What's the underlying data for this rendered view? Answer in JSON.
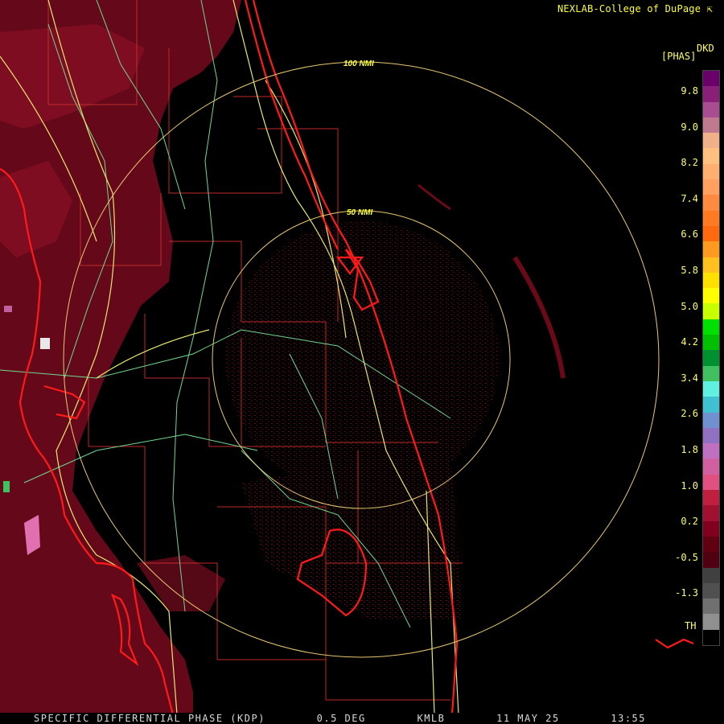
{
  "header": {
    "credit": "NEXLAB-College of DuPage ⇱"
  },
  "footer": {
    "product": "SPECIFIC DIFFERENTIAL PHASE (KDP)",
    "elevation": "0.5 DEG",
    "station": "KMLB",
    "date": "11 MAY 25",
    "time": "13:55"
  },
  "range_rings": [
    {
      "label": "100 NMI"
    },
    {
      "label": "50 NMI"
    }
  ],
  "legend": {
    "code": "DKD",
    "units": "[PHAS]",
    "labels": [
      "9.8",
      "9.0",
      "8.2",
      "7.4",
      "6.6",
      "5.8",
      "5.0",
      "4.2",
      "3.4",
      "2.6",
      "1.8",
      "1.0",
      "0.2",
      "-0.5",
      "-1.3"
    ],
    "threshold_label": "TH",
    "colors": [
      "#6a006a",
      "#8a1f7a",
      "#a84d8f",
      "#c07a8f",
      "#f0b088",
      "#ffc080",
      "#ffb070",
      "#ffa060",
      "#ff8a40",
      "#ff7a20",
      "#ff6a10",
      "#ff9a20",
      "#ffc020",
      "#ffe000",
      "#ffff00",
      "#c8ff00",
      "#00e000",
      "#00c000",
      "#009030",
      "#40c060",
      "#60f0e0",
      "#40c0d0",
      "#7090d0",
      "#9070c0",
      "#c070c0",
      "#d060a0",
      "#e05080",
      "#c02040",
      "#a01030",
      "#800020",
      "#600010",
      "#500010",
      "#404040",
      "#505050",
      "#707070",
      "#909090",
      "#000000"
    ]
  },
  "map": {
    "coast_color": "#ff0000",
    "county_line_color": "#d03030",
    "highway_color": "#e8e870",
    "road_color": "#80e0a0",
    "ring_color": "#e8c870",
    "echo_color": "#7a0a1c"
  }
}
